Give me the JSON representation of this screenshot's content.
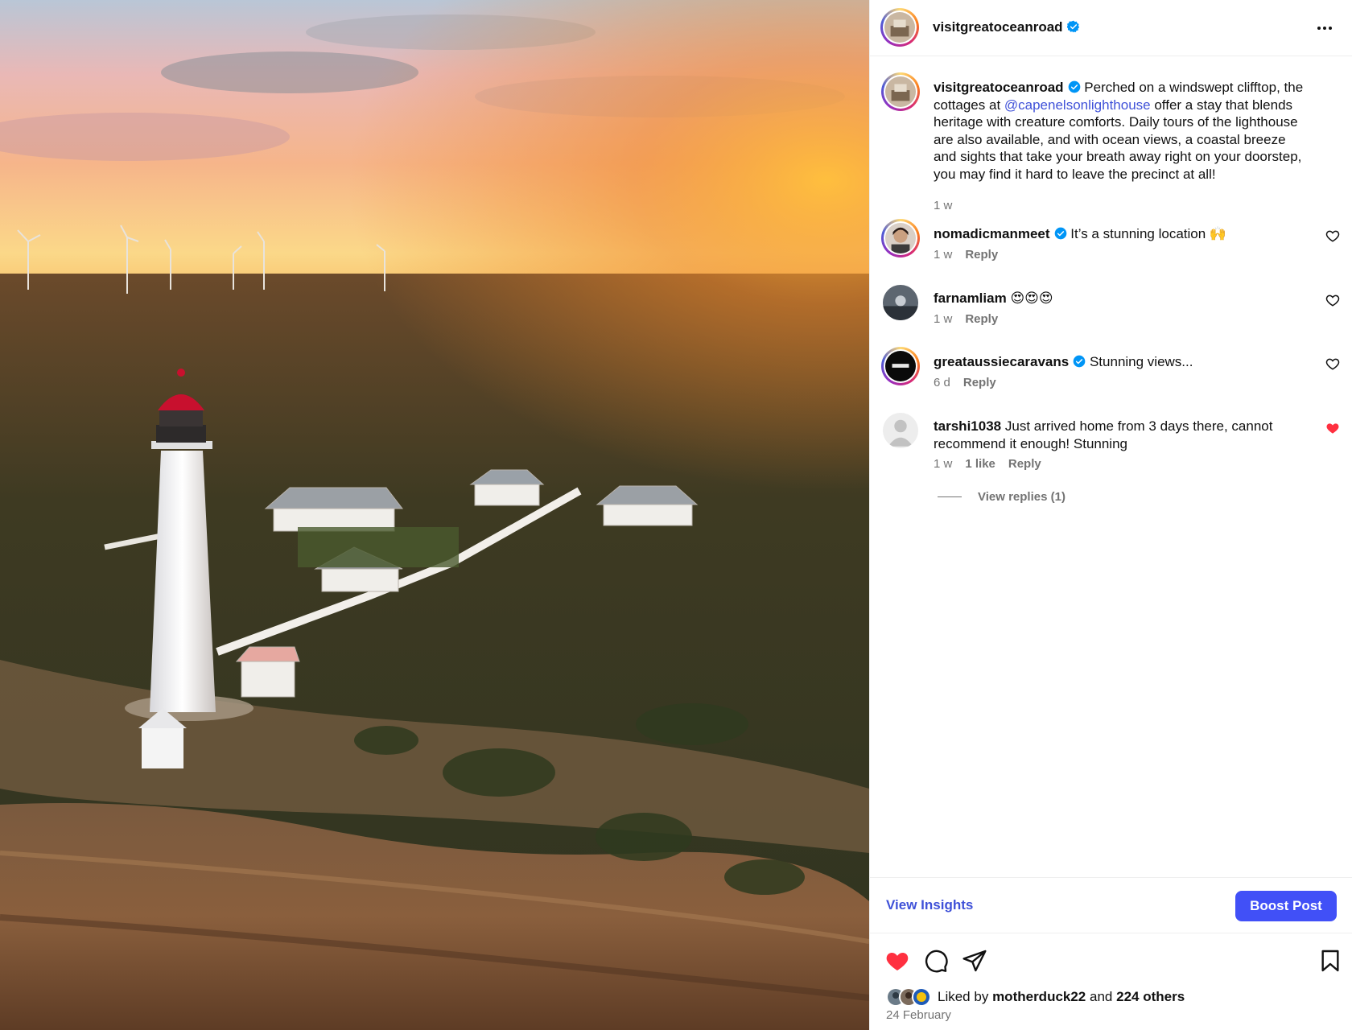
{
  "post": {
    "author": "visitgreatoceanroad",
    "verified_icon": "verified-badge-icon",
    "more_icon": "more-options-icon"
  },
  "caption": {
    "author": "visitgreatoceanroad",
    "text_before": "Perched on a windswept clifftop, the cottages at ",
    "mention": "@capenelsonlighthouse",
    "text_after": " offer a stay that blends heritage with creature comforts. Daily tours of the lighthouse are also available, and with ocean views, a coastal breeze and sights that take your breath away right on your doorstep, you may find it hard to leave the precinct at all!",
    "time": "1 w"
  },
  "comments": [
    {
      "user": "nomadicmanmeet",
      "verified": true,
      "text": "It’s a stunning location 🙌",
      "time": "1 w",
      "reply": "Reply",
      "liked": false
    },
    {
      "user": "farnamliam",
      "verified": false,
      "text": "😍😍😍",
      "time": "1 w",
      "reply": "Reply",
      "liked": false
    },
    {
      "user": "greataussiecaravans",
      "verified": true,
      "text": "Stunning views...",
      "time": "6 d",
      "reply": "Reply",
      "liked": false
    },
    {
      "user": "tarshi1038",
      "verified": false,
      "text": "Just arrived home from 3 days there, cannot recommend it enough! Stunning",
      "time": "1 w",
      "likes": "1 like",
      "reply": "Reply",
      "liked": true
    }
  ],
  "view_replies": "View replies (1)",
  "insights": {
    "view_label": "View Insights",
    "boost_label": "Boost Post"
  },
  "likes": {
    "prefix": "Liked by",
    "user": "motherduck22",
    "and": "and",
    "others": "224 others"
  },
  "date": "24 February",
  "colors": {
    "accent": "#4150f7",
    "link": "#3f51d8",
    "like_red": "#ff3040",
    "verified_blue": "#0095f6"
  }
}
